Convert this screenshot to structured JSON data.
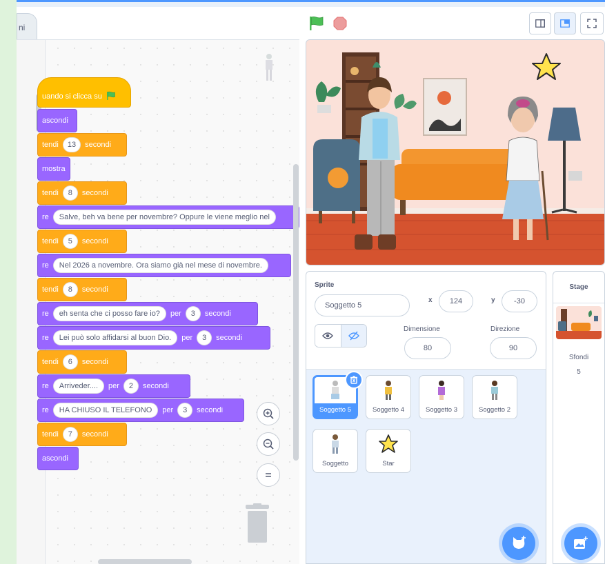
{
  "editor": {
    "tab_label": "ni"
  },
  "script": {
    "hat_text": "uando si clicca su",
    "b_hide1": "ascondi",
    "b_wait1": {
      "label": "tendi",
      "value": "13",
      "unit": "secondi"
    },
    "b_show": "mostra",
    "b_wait2": {
      "label": "tendi",
      "value": "8",
      "unit": "secondi"
    },
    "b_say1": {
      "label": "re",
      "text": "Salve, beh va bene per novembre? Oppure le viene meglio nel"
    },
    "b_wait3": {
      "label": "tendi",
      "value": "5",
      "unit": "secondi"
    },
    "b_say2": {
      "label": "re",
      "text": "Nel 2026 a novembre. Ora siamo già nel mese di novembre."
    },
    "b_wait4": {
      "label": "tendi",
      "value": "8",
      "unit": "secondi"
    },
    "b_sayfor1": {
      "label": "re",
      "text": "eh senta che ci posso fare io?",
      "per": "per",
      "value": "3",
      "unit": "secondi"
    },
    "b_sayfor2": {
      "label": "re",
      "text": "Lei può solo affidarsi al buon Dio.",
      "per": "per",
      "value": "3",
      "unit": "secondi"
    },
    "b_wait5": {
      "label": "tendi",
      "value": "6",
      "unit": "secondi"
    },
    "b_sayfor3": {
      "label": "re",
      "text": "Arriveder....",
      "per": "per",
      "value": "2",
      "unit": "secondi"
    },
    "b_sayfor4": {
      "label": "re",
      "text": "HA CHIUSO IL TELEFONO",
      "per": "per",
      "value": "3",
      "unit": "secondi"
    },
    "b_wait6": {
      "label": "tendi",
      "value": "7",
      "unit": "secondi"
    },
    "b_hide2": "ascondi"
  },
  "zoom": {
    "in": "+",
    "out": "−",
    "reset": "="
  },
  "sprite_info": {
    "sprite_label": "Sprite",
    "sprite_name": "Soggetto 5",
    "x_label": "x",
    "x_value": "124",
    "y_label": "y",
    "y_value": "-30",
    "size_label": "Dimensione",
    "size_value": "80",
    "direction_label": "Direzione",
    "direction_value": "90"
  },
  "sprites": [
    {
      "name": "Soggetto 5",
      "selected": true
    },
    {
      "name": "Soggetto 4",
      "selected": false
    },
    {
      "name": "Soggetto 3",
      "selected": false
    },
    {
      "name": "Soggetto 2",
      "selected": false
    },
    {
      "name": "Soggetto",
      "selected": false
    },
    {
      "name": "Star",
      "selected": false
    }
  ],
  "stage_panel": {
    "title": "Stage",
    "backdrops_label": "Sfondi",
    "backdrops_count": "5"
  },
  "colors": {
    "accent": "#4d97ff",
    "looks": "#9966ff",
    "control": "#ffab19",
    "events": "#ffbf00"
  }
}
